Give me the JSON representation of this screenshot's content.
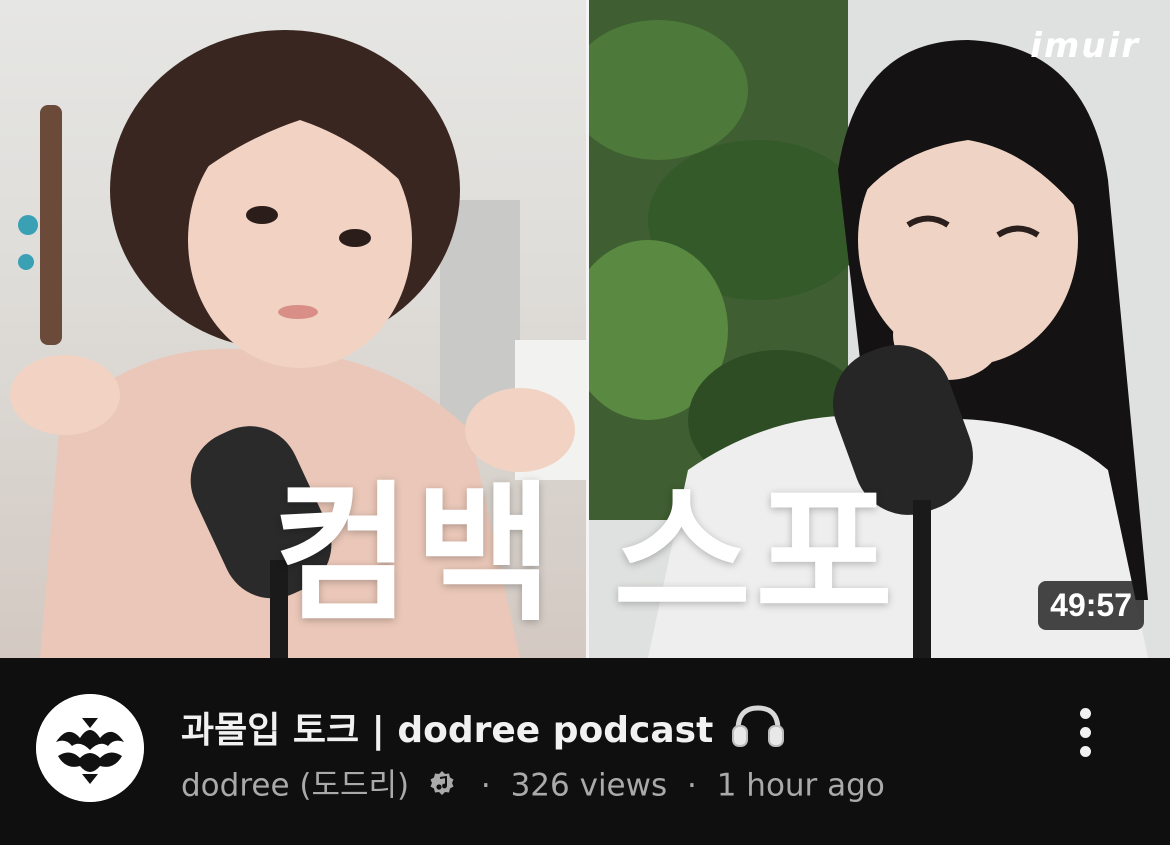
{
  "thumbnail": {
    "overlay_title": "컴백 스포",
    "brand": "imuir",
    "duration": "49:57"
  },
  "video": {
    "title": "과몰입 토크 | dodree podcast",
    "title_icon": "headphones-icon",
    "channel": "dodree (도드리)",
    "verified_icon": "music-note-badge-icon",
    "separator": "·",
    "views": "326 views",
    "age": "1 hour ago"
  },
  "menu": {
    "icon": "more-vertical-icon"
  },
  "colors": {
    "background": "#0f0f0f",
    "title_text": "#f1f1f1",
    "secondary_text": "#aaaaaa",
    "duration_badge": "#141414"
  }
}
